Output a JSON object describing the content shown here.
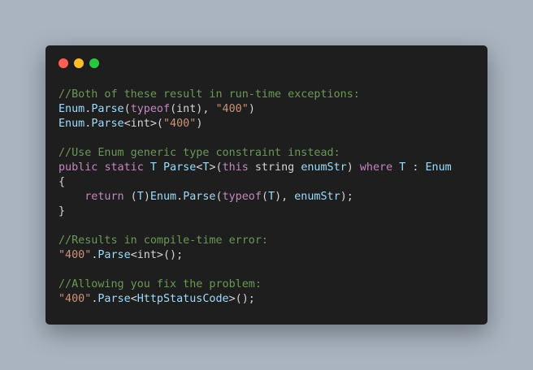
{
  "colors": {
    "background": "#a9b4c0",
    "window": "#1e1e1e",
    "dot_close": "#ff5f56",
    "dot_minimize": "#ffbd2e",
    "dot_maximize": "#27c93f",
    "comment": "#6a9955",
    "keyword": "#c586c0",
    "string": "#ce9178",
    "type": "#9cdcfe",
    "plain": "#d4d4d4"
  },
  "window_controls": [
    {
      "name": "close-dot",
      "color": "#ff5f56"
    },
    {
      "name": "minimize-dot",
      "color": "#ffbd2e"
    },
    {
      "name": "maximize-dot",
      "color": "#27c93f"
    }
  ],
  "code": {
    "lines": [
      [
        {
          "t": "comment",
          "v": "//Both of these result in run-time exceptions:"
        }
      ],
      [
        {
          "t": "type",
          "v": "Enum"
        },
        {
          "t": "plain",
          "v": "."
        },
        {
          "t": "ident",
          "v": "Parse"
        },
        {
          "t": "plain",
          "v": "("
        },
        {
          "t": "keyword",
          "v": "typeof"
        },
        {
          "t": "plain",
          "v": "(int), "
        },
        {
          "t": "string",
          "v": "\"400\""
        },
        {
          "t": "plain",
          "v": ")"
        }
      ],
      [
        {
          "t": "type",
          "v": "Enum"
        },
        {
          "t": "plain",
          "v": "."
        },
        {
          "t": "ident",
          "v": "Parse"
        },
        {
          "t": "plain",
          "v": "<int>("
        },
        {
          "t": "string",
          "v": "\"400\""
        },
        {
          "t": "plain",
          "v": ")"
        }
      ],
      [],
      [
        {
          "t": "comment",
          "v": "//Use Enum generic type constraint instead:"
        }
      ],
      [
        {
          "t": "keyword",
          "v": "public"
        },
        {
          "t": "plain",
          "v": " "
        },
        {
          "t": "keyword",
          "v": "static"
        },
        {
          "t": "plain",
          "v": " "
        },
        {
          "t": "type",
          "v": "T"
        },
        {
          "t": "plain",
          "v": " "
        },
        {
          "t": "ident",
          "v": "Parse"
        },
        {
          "t": "plain",
          "v": "<"
        },
        {
          "t": "type",
          "v": "T"
        },
        {
          "t": "plain",
          "v": ">("
        },
        {
          "t": "keyword",
          "v": "this"
        },
        {
          "t": "plain",
          "v": " string "
        },
        {
          "t": "ident",
          "v": "enumStr"
        },
        {
          "t": "plain",
          "v": ") "
        },
        {
          "t": "keyword",
          "v": "where"
        },
        {
          "t": "plain",
          "v": " "
        },
        {
          "t": "type",
          "v": "T"
        },
        {
          "t": "plain",
          "v": " : "
        },
        {
          "t": "type",
          "v": "Enum"
        }
      ],
      [
        {
          "t": "plain",
          "v": "{"
        }
      ],
      [
        {
          "t": "plain",
          "v": "    "
        },
        {
          "t": "keyword",
          "v": "return"
        },
        {
          "t": "plain",
          "v": " ("
        },
        {
          "t": "type",
          "v": "T"
        },
        {
          "t": "plain",
          "v": ")"
        },
        {
          "t": "type",
          "v": "Enum"
        },
        {
          "t": "plain",
          "v": "."
        },
        {
          "t": "ident",
          "v": "Parse"
        },
        {
          "t": "plain",
          "v": "("
        },
        {
          "t": "keyword",
          "v": "typeof"
        },
        {
          "t": "plain",
          "v": "("
        },
        {
          "t": "type",
          "v": "T"
        },
        {
          "t": "plain",
          "v": "), "
        },
        {
          "t": "ident",
          "v": "enumStr"
        },
        {
          "t": "plain",
          "v": ");"
        }
      ],
      [
        {
          "t": "plain",
          "v": "}"
        }
      ],
      [],
      [
        {
          "t": "comment",
          "v": "//Results in compile-time error:"
        }
      ],
      [
        {
          "t": "string",
          "v": "\"400\""
        },
        {
          "t": "plain",
          "v": "."
        },
        {
          "t": "ident",
          "v": "Parse"
        },
        {
          "t": "plain",
          "v": "<int>();"
        }
      ],
      [],
      [
        {
          "t": "comment",
          "v": "//Allowing you fix the problem:"
        }
      ],
      [
        {
          "t": "string",
          "v": "\"400\""
        },
        {
          "t": "plain",
          "v": "."
        },
        {
          "t": "ident",
          "v": "Parse"
        },
        {
          "t": "plain",
          "v": "<"
        },
        {
          "t": "type",
          "v": "HttpStatusCode"
        },
        {
          "t": "plain",
          "v": ">();"
        }
      ]
    ]
  }
}
